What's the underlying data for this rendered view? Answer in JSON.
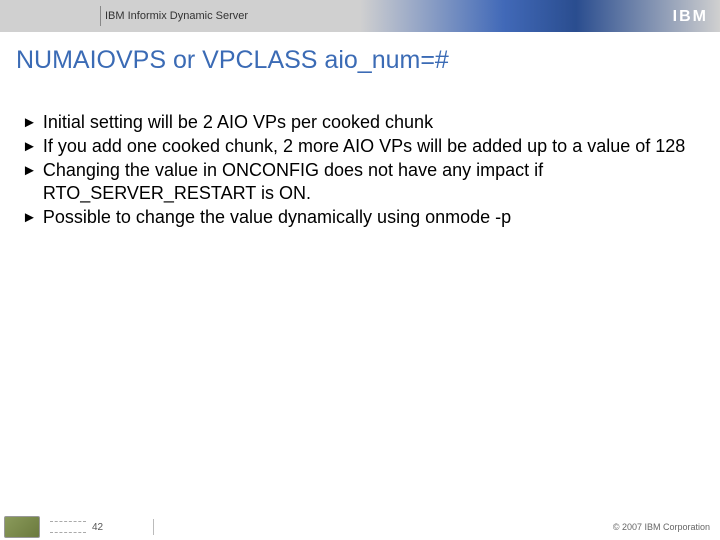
{
  "header": {
    "product": "IBM Informix Dynamic Server",
    "logo": "IBM"
  },
  "title": "NUMAIOVPS  or VPCLASS aio_num=#",
  "bullets": [
    "Initial setting will be 2 AIO VPs per cooked chunk",
    "If you add one cooked chunk, 2 more AIO VPs will be added up to a value of 128",
    "Changing the value in ONCONFIG does not have any impact if RTO_SERVER_RESTART is ON.",
    "Possible to change the value dynamically using onmode -p"
  ],
  "footer": {
    "page": "42",
    "copyright": "© 2007 IBM Corporation"
  }
}
